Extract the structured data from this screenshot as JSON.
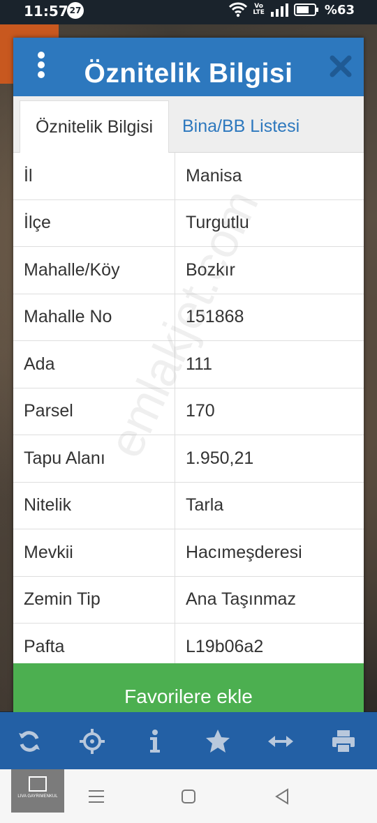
{
  "status_bar": {
    "time": "11:57",
    "notification_count": "27",
    "volte_label": "Vo\nLTE",
    "battery": "%63"
  },
  "modal": {
    "title": "Öznitelik Bilgisi",
    "tabs": [
      {
        "label": "Öznitelik Bilgisi",
        "active": true
      },
      {
        "label": "Bina/BB Listesi",
        "active": false
      }
    ],
    "rows": [
      {
        "key": "İl",
        "value": "Manisa"
      },
      {
        "key": "İlçe",
        "value": "Turgutlu"
      },
      {
        "key": "Mahalle/Köy",
        "value": "Bozkır"
      },
      {
        "key": "Mahalle No",
        "value": "151868"
      },
      {
        "key": "Ada",
        "value": "111"
      },
      {
        "key": "Parsel",
        "value": "170"
      },
      {
        "key": "Tapu Alanı",
        "value": "1.950,21"
      },
      {
        "key": "Nitelik",
        "value": "Tarla"
      },
      {
        "key": "Mevkii",
        "value": "Hacımeşderesi"
      },
      {
        "key": "Zemin Tip",
        "value": "Ana Taşınmaz"
      },
      {
        "key": "Pafta",
        "value": "L19b06a2"
      }
    ],
    "favorite_button": "Favorilere ekle"
  },
  "watermark": "emlakjet.com",
  "toolbar_icons": [
    "refresh-icon",
    "locate-icon",
    "info-icon",
    "star-icon",
    "measure-icon",
    "print-icon"
  ],
  "nav_logo_text": "LIVA GAYRIMENKUL",
  "colors": {
    "header_blue": "#2d78be",
    "toolbar_blue": "#2360a5",
    "button_green": "#4caf50"
  }
}
